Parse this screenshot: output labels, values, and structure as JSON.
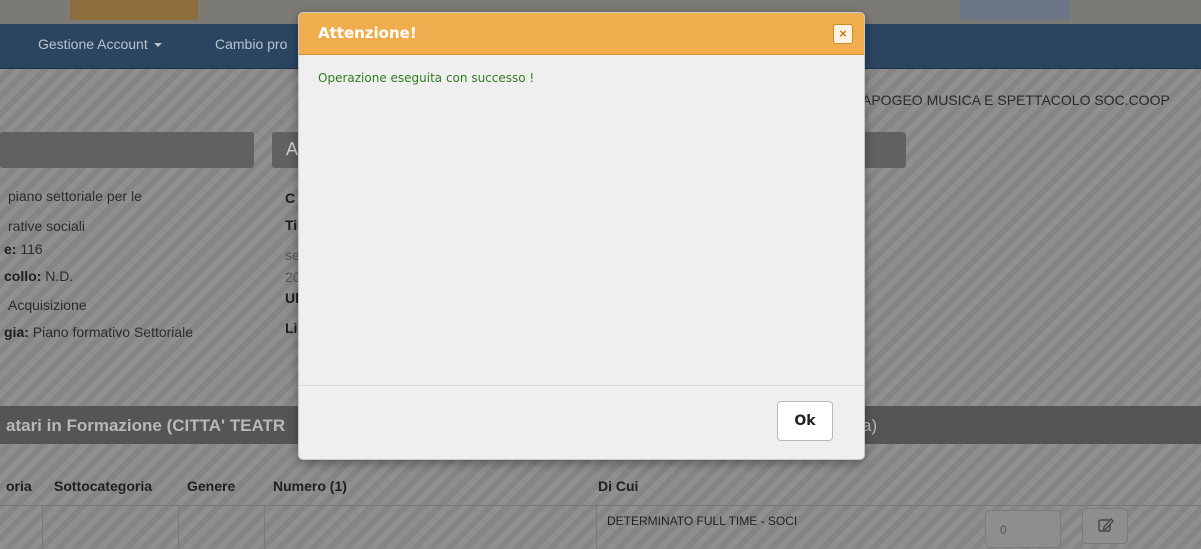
{
  "navbar": {
    "account_menu": "Gestione Account",
    "cambio_label": "Cambio pro"
  },
  "org": {
    "name": "APOGEO MUSICA E SPETTACOLO SOC.COOP"
  },
  "panel_middle": {
    "head": "A"
  },
  "info_left": [
    {
      "label": "",
      "value": "piano settoriale per le"
    },
    {
      "label": "",
      "value": "rative sociali"
    },
    {
      "label": "e:",
      "value": " 116"
    },
    {
      "label": "collo:",
      "value": " N.D."
    },
    {
      "label": "",
      "value": "Acquisizione"
    },
    {
      "label": "gia:",
      "value": " Piano formativo Settoriale"
    }
  ],
  "info_mid": [
    "C",
    "Ti",
    "se",
    "20",
    "Ul",
    "Li"
  ],
  "section": {
    "title": "atari in Formazione (CITTA' TEATR",
    "title_right": "a)"
  },
  "table": {
    "headers": [
      "oria",
      "Sottocategoria",
      "Genere",
      "Numero (1)",
      "Di Cui"
    ],
    "row": {
      "di_cui": "DETERMINATO FULL TIME - SOCI",
      "value": "0"
    }
  },
  "modal": {
    "title": "Attenzione!",
    "close_label": "×",
    "message": "Operazione eseguita con successo !",
    "ok_label": "Ok"
  }
}
